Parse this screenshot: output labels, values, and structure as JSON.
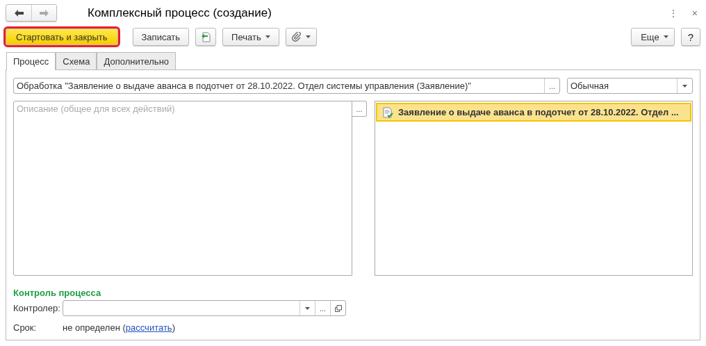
{
  "window": {
    "title": "Комплексный процесс (создание)",
    "menu_icon": "⋮",
    "close_icon": "×"
  },
  "toolbar": {
    "buttons": [
      {
        "kind": "primary",
        "label": "Стартовать и закрыть",
        "highlighted": true
      },
      {
        "kind": "text",
        "label": "Записать"
      },
      {
        "kind": "icon"
      },
      {
        "kind": "menu",
        "label": "Печать"
      },
      {
        "kind": "clip"
      }
    ],
    "more": "Еще",
    "help": "?"
  },
  "tabs": [
    {
      "label": "Процесс",
      "selected": true
    },
    {
      "label": "Схема",
      "selected": false
    },
    {
      "label": "Дополнительно",
      "selected": false
    }
  ],
  "subject": {
    "value": "Обработка \"Заявление о выдаче аванса в подотчет от 28.10.2022. Отдел системы управления (Заявление)\"",
    "button": "..."
  },
  "importance": {
    "value": "Обычная"
  },
  "description": {
    "placeholder": "Описание (общее для всех действий)",
    "button": "..."
  },
  "tasks": [
    {
      "label": "Заявление о выдаче аванса в подотчет от 28.10.2022. Отдел ...",
      "selected": true
    }
  ],
  "control": {
    "heading": "Контроль процесса",
    "controller_label": "Контролер:",
    "controller_button": "...",
    "deadline_label": "Срок:",
    "deadline_before": "не определен (",
    "deadline_link": "рассчитать",
    "deadline_after": ")"
  }
}
